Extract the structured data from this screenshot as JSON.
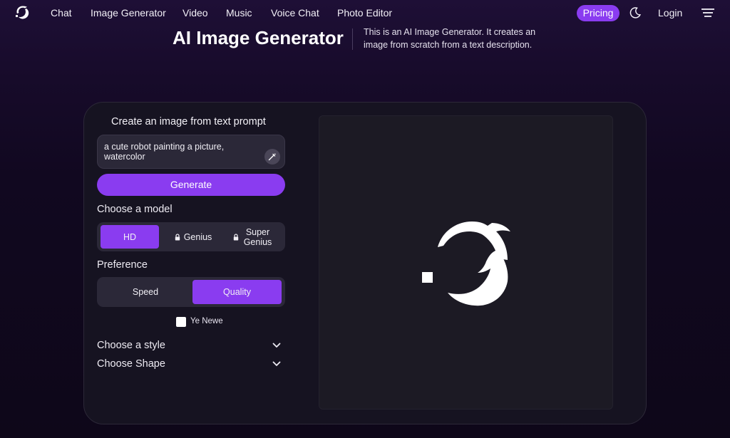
{
  "nav": {
    "links": [
      "Chat",
      "Image Generator",
      "Video",
      "Music",
      "Voice Chat",
      "Photo Editor"
    ],
    "pricing": "Pricing",
    "login": "Login"
  },
  "header": {
    "title": "AI Image Generator",
    "description": "This is an AI Image Generator. It creates an image from scratch from a text description."
  },
  "form": {
    "section_title": "Create an image from text prompt",
    "prompt_value": "a cute robot painting a picture, watercolor",
    "generate_label": "Generate",
    "model_label": "Choose a model",
    "models": [
      {
        "label": "HD",
        "locked": false,
        "selected": true
      },
      {
        "label": "Genius",
        "locked": true,
        "selected": false
      },
      {
        "label": "Super Genius",
        "locked": true,
        "selected": false
      }
    ],
    "preference_label": "Preference",
    "preferences": [
      {
        "label": "Speed",
        "selected": false
      },
      {
        "label": "Quality",
        "selected": true
      }
    ],
    "checkbox_label": "Ye Newe",
    "checkbox_checked": false,
    "style_label": "Choose a style",
    "shape_label": "Choose Shape"
  },
  "colors": {
    "accent": "#8a3cf0",
    "card": "#161321",
    "control": "#2b2838"
  },
  "icons": {
    "logo": "dolphin-logo-icon",
    "theme": "moon-icon",
    "menu": "hamburger-menu-icon",
    "enhance": "magic-wand-icon",
    "lock": "lock-icon",
    "chevron": "chevron-down-icon"
  }
}
